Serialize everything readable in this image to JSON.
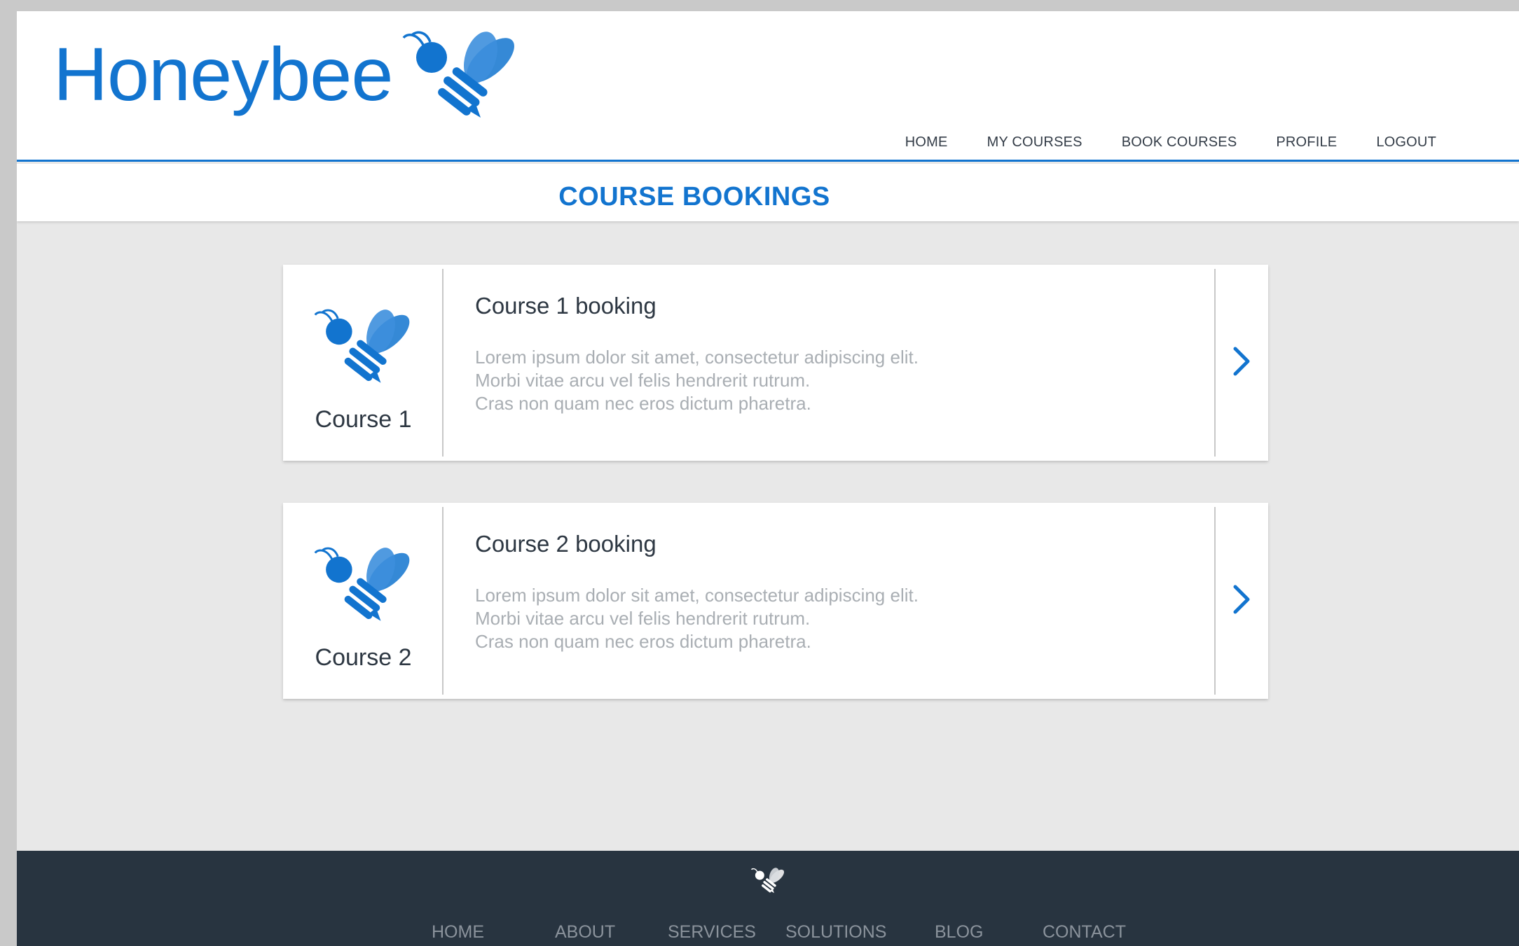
{
  "brand": {
    "name": "Honeybee",
    "logo_icon": "bee-icon",
    "accent_color": "#1274cf",
    "footer_color": "#283440"
  },
  "nav": {
    "items": [
      {
        "label": "HOME",
        "active": false
      },
      {
        "label": "MY COURSES",
        "active": false
      },
      {
        "label": "BOOK COURSES",
        "active": true
      },
      {
        "label": "PROFILE",
        "active": false
      },
      {
        "label": "LOGOUT",
        "active": false
      }
    ]
  },
  "page": {
    "title": "COURSE BOOKINGS"
  },
  "courses": [
    {
      "name": "Course 1",
      "heading": "Course 1 booking",
      "description": [
        "Lorem ipsum dolor sit amet, consectetur adipiscing elit.",
        "Morbi vitae arcu vel felis hendrerit rutrum.",
        "Cras non quam nec eros dictum pharetra."
      ],
      "icon": "chevron-right-icon"
    },
    {
      "name": "Course 2",
      "heading": "Course 2 booking",
      "description": [
        "Lorem ipsum dolor sit amet, consectetur adipiscing elit.",
        "Morbi vitae arcu vel felis hendrerit rutrum.",
        "Cras non quam nec eros dictum pharetra."
      ],
      "icon": "chevron-right-icon"
    }
  ],
  "footer": {
    "items": [
      "HOME",
      "ABOUT",
      "SERVICES",
      "SOLUTIONS",
      "BLOG",
      "CONTACT"
    ]
  }
}
